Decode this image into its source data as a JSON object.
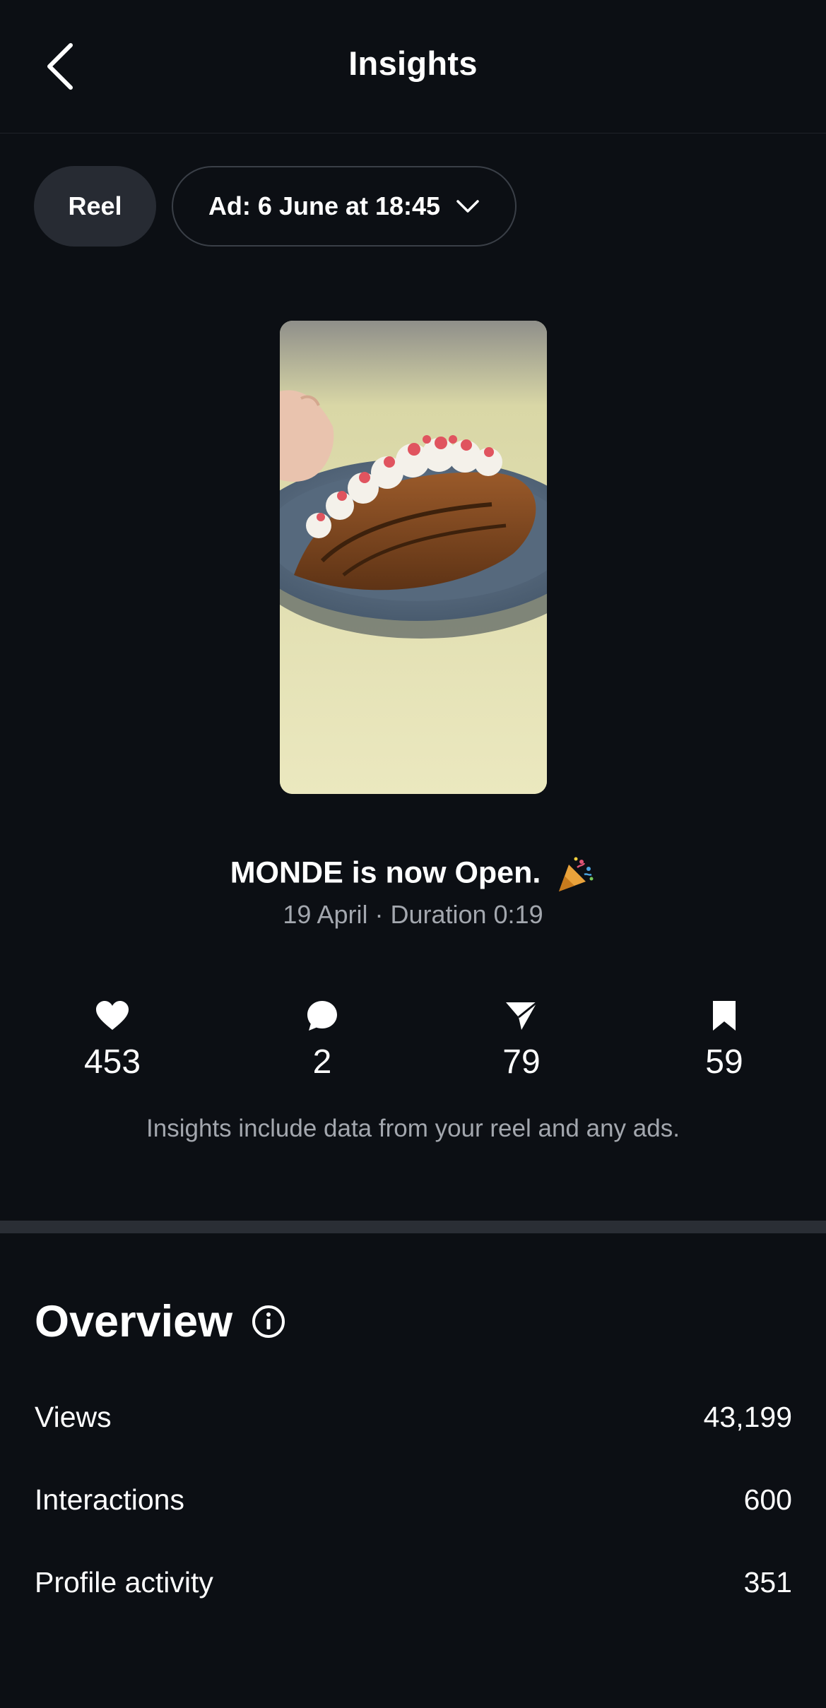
{
  "header": {
    "title": "Insights"
  },
  "filters": {
    "type_label": "Reel",
    "ad_label": "Ad: 6 June at 18:45"
  },
  "post": {
    "title": "MONDE is now Open.",
    "subtitle": "19 April · Duration 0:19"
  },
  "stats": [
    {
      "icon": "heart-icon",
      "value": "453"
    },
    {
      "icon": "comment-icon",
      "value": "2"
    },
    {
      "icon": "share-icon",
      "value": "79"
    },
    {
      "icon": "bookmark-icon",
      "value": "59"
    }
  ],
  "note": "Insights include data from your reel and any ads.",
  "overview": {
    "title": "Overview",
    "rows": [
      {
        "label": "Views",
        "value": "43,199"
      },
      {
        "label": "Interactions",
        "value": "600"
      },
      {
        "label": "Profile activity",
        "value": "351"
      }
    ]
  }
}
